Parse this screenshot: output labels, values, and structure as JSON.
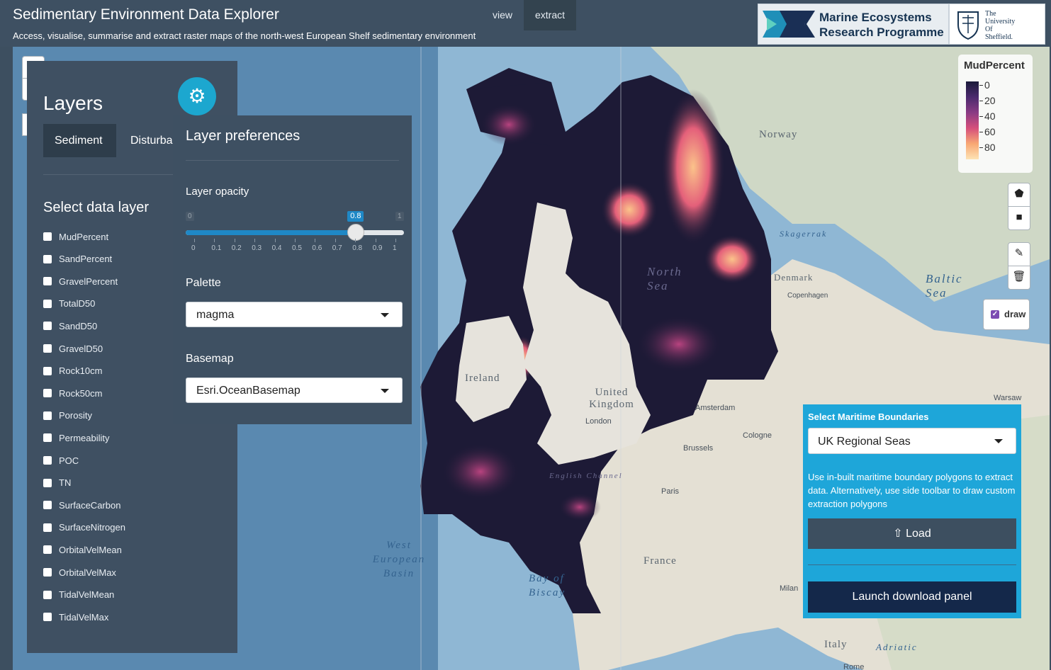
{
  "header": {
    "title": "Sedimentary Environment Data Explorer",
    "subtitle": "Access, visualise, summarise and extract raster maps of the north-west European Shelf sedimentary environment",
    "nav": [
      "view",
      "extract"
    ],
    "active_nav": "extract",
    "logo_primary": [
      "Marine Ecosystems",
      "Research Programme"
    ],
    "logo_secondary": [
      "The",
      "University",
      "Of",
      "Sheffield."
    ]
  },
  "map_controls": {
    "zoom_in": "+",
    "zoom_out": "−"
  },
  "layers_panel": {
    "title": "Layers",
    "tabs": [
      "Sediment",
      "Disturbar"
    ],
    "active_tab": "Sediment",
    "section_title": "Select data layer",
    "layers": [
      "MudPercent",
      "SandPercent",
      "GravelPercent",
      "TotalD50",
      "SandD50",
      "GravelD50",
      "Rock10cm",
      "Rock50cm",
      "Porosity",
      "Permeability",
      "POC",
      "TN",
      "SurfaceCarbon",
      "SurfaceNitrogen",
      "OrbitalVelMean",
      "OrbitalVelMax",
      "TidalVelMean",
      "TidalVelMax"
    ],
    "checked": []
  },
  "preferences": {
    "title": "Layer preferences",
    "opacity_label": "Layer opacity",
    "opacity": {
      "min": "0",
      "max": "1",
      "value": 0.8,
      "value_text": "0.8",
      "ticks": [
        "0",
        "0.1",
        "0.2",
        "0.3",
        "0.4",
        "0.5",
        "0.6",
        "0.7",
        "0.8",
        "0.9",
        "1"
      ]
    },
    "palette_label": "Palette",
    "palette_value": "magma",
    "basemap_label": "Basemap",
    "basemap_value": "Esri.OceanBasemap"
  },
  "legend": {
    "title": "MudPercent",
    "labels": [
      "0",
      "20",
      "40",
      "60",
      "80"
    ]
  },
  "draw_toolbar": {
    "icons": [
      "polygon-icon",
      "rectangle-icon",
      "edit-icon",
      "trash-icon"
    ],
    "toggle_label": "draw",
    "toggle_checked": true
  },
  "extract_panel": {
    "title": "Select Maritime Boundaries",
    "selected": "UK Regional Seas",
    "help": "Use in-built maritime boundary polygons to extract data. Alternatively, use side toolbar to draw custom extraction polygons",
    "load_label": "Load",
    "download_label": "Launch download panel"
  },
  "map_labels": {
    "countries": [
      "Norway",
      "Ireland",
      "United Kingdom",
      "Denmark",
      "France",
      "Italy"
    ],
    "seas": [
      "North Sea",
      "Baltic Sea",
      "West European Basin",
      "Bay of Biscay",
      "Skagerrak",
      "English Channel",
      "Adriatic"
    ],
    "cities": [
      "London",
      "Brussels",
      "Amsterdam",
      "Cologne",
      "Paris",
      "Copenhagen",
      "Warsaw",
      "Milan",
      "Rome"
    ]
  }
}
